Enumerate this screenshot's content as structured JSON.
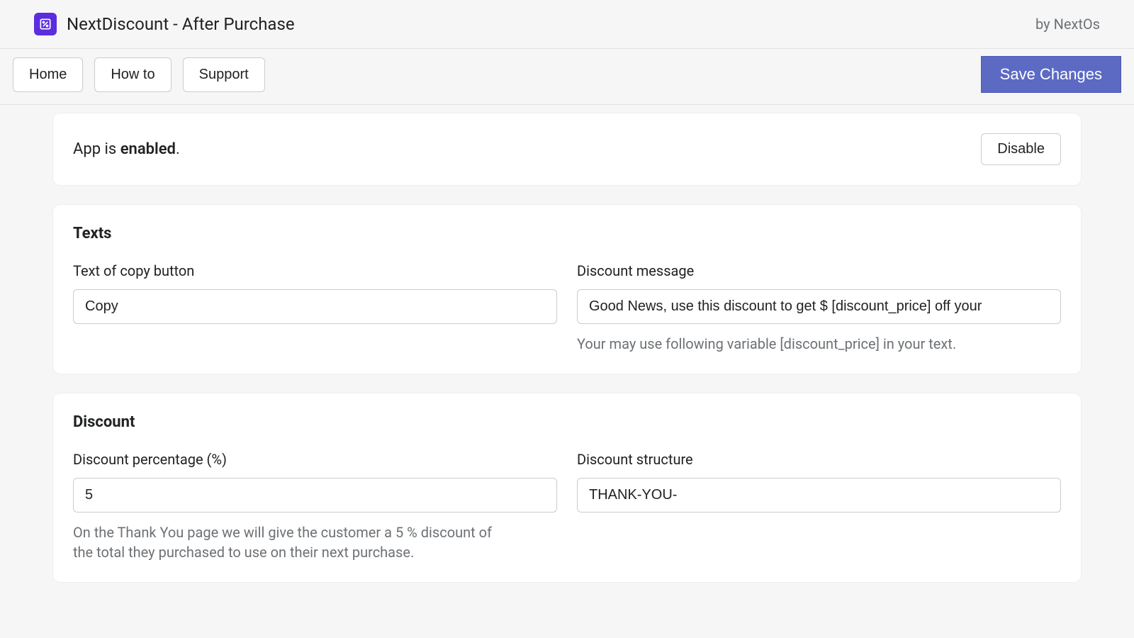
{
  "header": {
    "title": "NextDiscount - After Purchase",
    "by": "by NextOs"
  },
  "toolbar": {
    "home": "Home",
    "howto": "How to",
    "support": "Support",
    "save": "Save Changes"
  },
  "status": {
    "prefix": "App is ",
    "state": "enabled",
    "suffix": ".",
    "disable": "Disable"
  },
  "texts": {
    "title": "Texts",
    "copy_label": "Text of copy button",
    "copy_value": "Copy",
    "message_label": "Discount message",
    "message_value": "Good News, use this discount to get $ [discount_price] off your",
    "message_hint": "Your may use following variable [discount_price] in your text."
  },
  "discount": {
    "title": "Discount",
    "percent_label": "Discount percentage (%)",
    "percent_value": "5",
    "percent_hint": "On the Thank You page we will give the customer a 5 % discount of the total they purchased to use on their next purchase.",
    "structure_label": "Discount structure",
    "structure_value": "THANK-YOU-"
  }
}
